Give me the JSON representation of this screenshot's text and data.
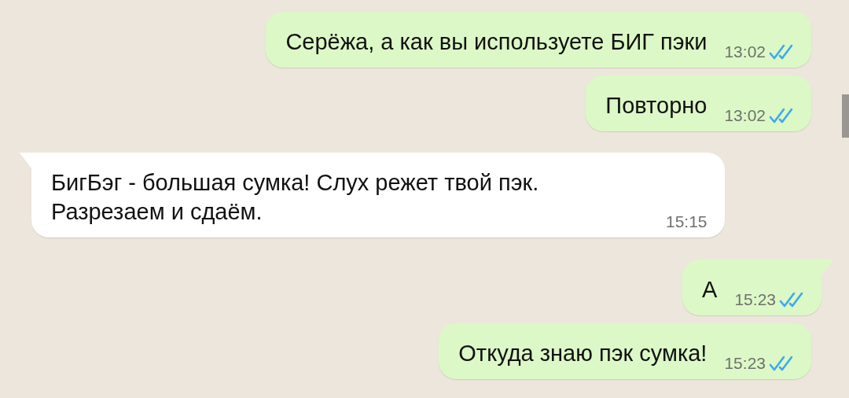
{
  "messages": [
    {
      "kind": "outgoing",
      "tail": false,
      "text": "Серёжа, а как вы используете БИГ пэки",
      "time": "13:02",
      "read": true
    },
    {
      "kind": "outgoing",
      "tail": false,
      "text": "Повторно",
      "time": "13:02",
      "read": true
    },
    {
      "kind": "incoming",
      "tail": true,
      "text": "БигБэг - большая сумка! Слух режет твой пэк. Разрезаем и сдаём.",
      "time": "15:15"
    },
    {
      "kind": "outgoing",
      "tail": true,
      "text": "А",
      "time": "15:23",
      "read": true
    },
    {
      "kind": "outgoing",
      "tail": false,
      "text": "Откуда знаю пэк сумка!",
      "time": "15:23",
      "read": true
    }
  ]
}
